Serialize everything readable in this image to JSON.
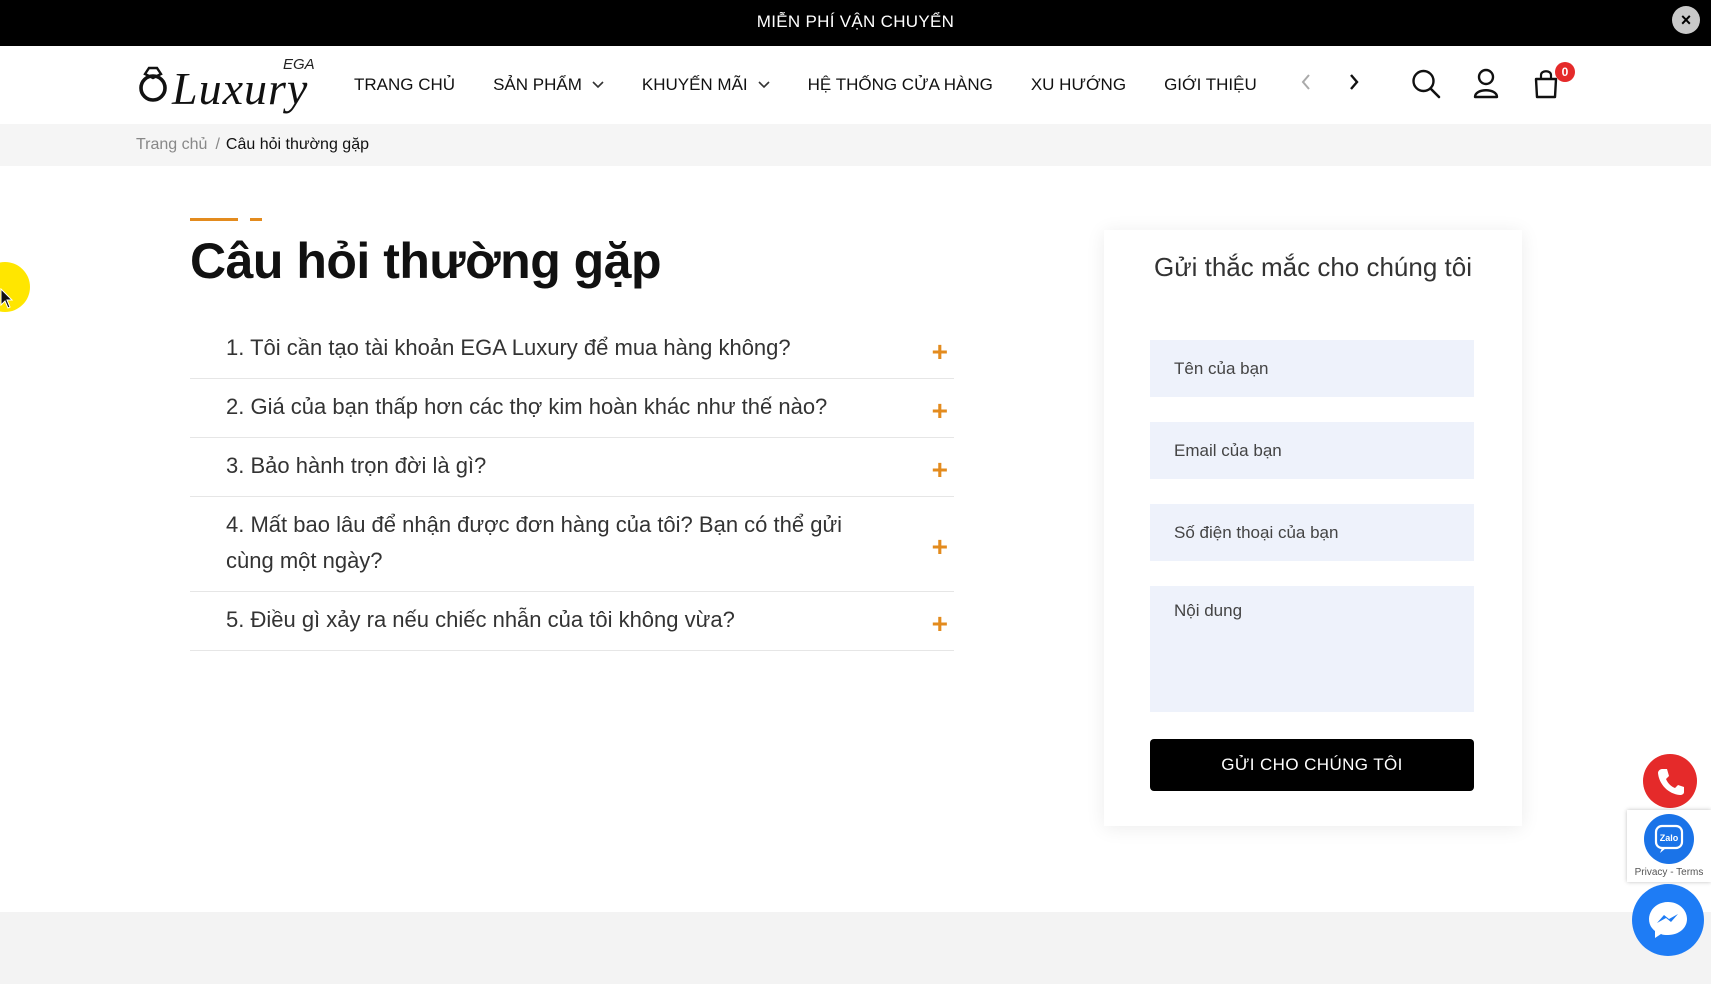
{
  "topbar": {
    "message": "MIỄN PHÍ VẬN CHUYỂN",
    "close_label": "×"
  },
  "header": {
    "logo": {
      "text": "Luxury",
      "badge": "EGA"
    },
    "nav": [
      {
        "label": "TRANG CHỦ",
        "has_dropdown": false
      },
      {
        "label": "SẢN PHẨM",
        "has_dropdown": true
      },
      {
        "label": "KHUYẾN MÃI",
        "has_dropdown": true
      },
      {
        "label": "HỆ THỐNG CỬA HÀNG",
        "has_dropdown": false
      },
      {
        "label": "XU HƯỚNG",
        "has_dropdown": false
      },
      {
        "label": "GIỚI THIỆU",
        "has_dropdown": false
      }
    ],
    "cart_count": "0"
  },
  "breadcrumb": {
    "home": "Trang chủ",
    "separator": "/",
    "current": "Câu hỏi thường gặp"
  },
  "faq": {
    "title": "Câu hỏi thường gặp",
    "expand_symbol": "+",
    "items": [
      "1. Tôi cần tạo tài khoản EGA Luxury để mua hàng không?",
      "2. Giá của bạn thấp hơn các thợ kim hoàn khác như thế nào?",
      "3. Bảo hành trọn đời là gì?",
      "4. Mất bao lâu để nhận được đơn hàng của tôi? Bạn có thể gửi cùng một ngày?",
      "5. Điều gì xảy ra nếu chiếc nhẫn của tôi không vừa?"
    ]
  },
  "contact_form": {
    "title": "Gửi thắc mắc cho chúng tôi",
    "name_placeholder": "Tên của bạn",
    "email_placeholder": "Email của bạn",
    "phone_placeholder": "Số điện thoại của bạn",
    "message_placeholder": "Nội dung",
    "submit_label": "GỬI CHO CHÚNG TÔI"
  },
  "widgets": {
    "zalo_label": "Zalo",
    "recaptcha_terms": "Privacy - Terms"
  },
  "colors": {
    "accent": "#e38b1e",
    "topbar_bg": "#000000",
    "input_bg": "#eef2fb",
    "badge": "#e52a2a",
    "phone": "#e52a2a",
    "zalo": "#1a73e8",
    "messenger": "#1e7cf5"
  },
  "icons": [
    "ring-logo-icon",
    "chevron-down-icon",
    "chevron-left-icon",
    "chevron-right-icon",
    "search-icon",
    "user-icon",
    "cart-icon",
    "plus-icon",
    "phone-icon",
    "zalo-icon",
    "messenger-icon",
    "close-icon"
  ]
}
